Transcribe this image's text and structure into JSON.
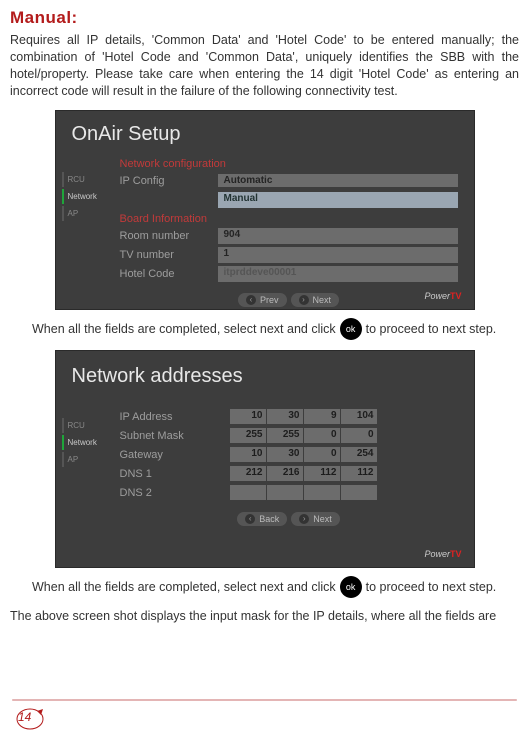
{
  "heading": "Manual:",
  "intro": "Requires all IP details, 'Common Data' and 'Hotel Code' to be entered manually; the combination of 'Hotel Code and 'Common Data', uniquely identifies the SBB with the hotel/property. Please take care when entering the 14 digit 'Hotel Code' as entering an incorrect code will result in the failure of the following connectivity test.",
  "step_a": "When all the fields are  completed,  select next and click",
  "step_b": "to proceed to next step.",
  "ok": "ok",
  "footer_text": "The above screen shot displays the input mask for the IP details, where all the fields are",
  "page_number": "14",
  "shot1": {
    "title": "OnAir Setup",
    "tabs": {
      "rcu": "RCU",
      "network": "Network",
      "ap": "AP"
    },
    "sect_net": "Network configuration",
    "ipconfig_label": "IP Config",
    "ipconfig_auto": "Automatic",
    "ipconfig_manual": "Manual",
    "sect_board": "Board Information",
    "room_label": "Room number",
    "room_val": "904",
    "tv_label": "TV number",
    "tv_val": "1",
    "hotel_label": "Hotel Code",
    "hotel_val": "itprddeve00001",
    "prev": "Prev",
    "next": "Next",
    "logo_a": "Power",
    "logo_b": "TV"
  },
  "shot2": {
    "title": "Network addresses",
    "tabs": {
      "rcu": "RCU",
      "network": "Network",
      "ap": "AP"
    },
    "rows": [
      {
        "label": "IP Address",
        "c": [
          "10",
          "30",
          "9",
          "104"
        ]
      },
      {
        "label": "Subnet Mask",
        "c": [
          "255",
          "255",
          "0",
          "0"
        ]
      },
      {
        "label": "Gateway",
        "c": [
          "10",
          "30",
          "0",
          "254"
        ]
      },
      {
        "label": "DNS 1",
        "c": [
          "212",
          "216",
          "112",
          "112"
        ]
      },
      {
        "label": "DNS 2",
        "c": [
          "",
          "",
          "",
          ""
        ]
      }
    ],
    "back": "Back",
    "next": "Next",
    "logo_a": "Power",
    "logo_b": "TV"
  }
}
